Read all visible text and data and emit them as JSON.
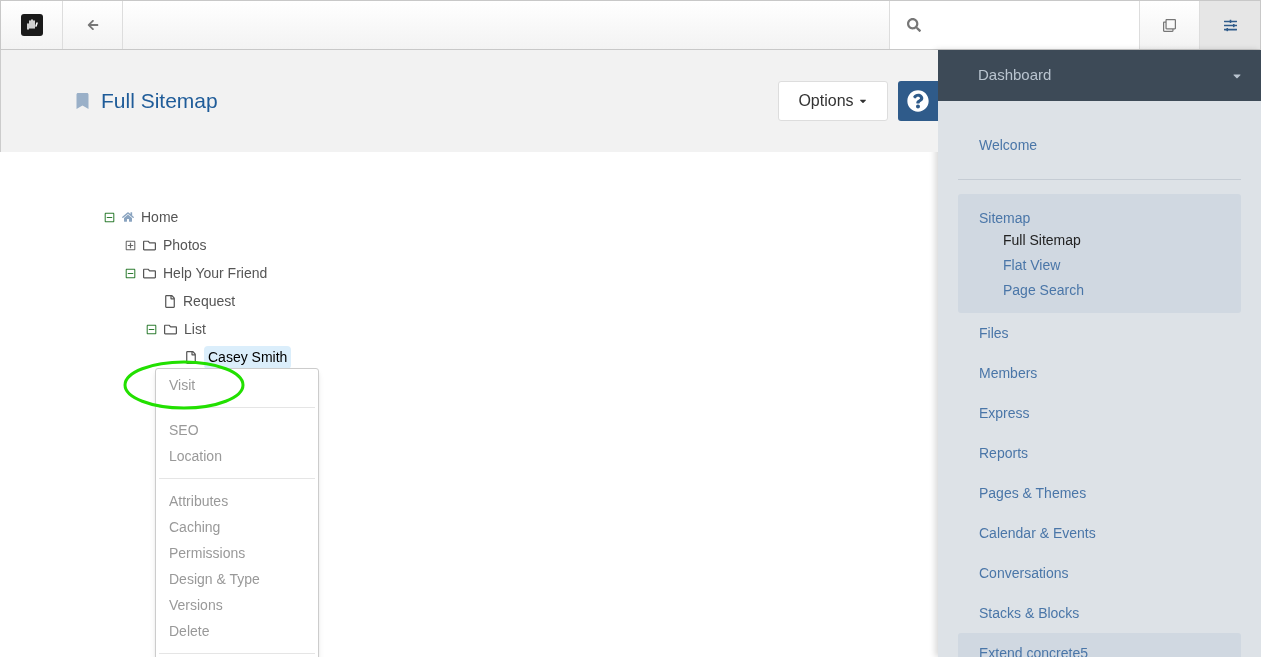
{
  "page": {
    "title": "Full Sitemap"
  },
  "header_buttons": {
    "options": "Options"
  },
  "tree": [
    {
      "kind": "home",
      "label": "Home",
      "expanded": true,
      "selected": false,
      "children": [
        {
          "kind": "folder",
          "label": "Photos",
          "expanded": false,
          "selected": false
        },
        {
          "kind": "folder",
          "label": "Help Your Friend",
          "expanded": true,
          "selected": false,
          "children": [
            {
              "kind": "page",
              "label": "Request",
              "selected": false
            },
            {
              "kind": "folder",
              "label": "List",
              "expanded": true,
              "selected": false,
              "children": [
                {
                  "kind": "page",
                  "label": "Casey Smith",
                  "selected": true
                }
              ]
            }
          ]
        }
      ]
    }
  ],
  "context_menu": {
    "groups": [
      [
        "Visit"
      ],
      [
        "SEO",
        "Location"
      ],
      [
        "Attributes",
        "Caching",
        "Permissions",
        "Design & Type",
        "Versions",
        "Delete"
      ]
    ]
  },
  "sidebar": {
    "header": "Dashboard",
    "items": [
      {
        "label": "Welcome",
        "selected": false
      },
      {
        "label": "Sitemap",
        "selected": true,
        "children": [
          {
            "label": "Full Sitemap",
            "selected": true
          },
          {
            "label": "Flat View",
            "selected": false
          },
          {
            "label": "Page Search",
            "selected": false
          }
        ]
      },
      {
        "label": "Files",
        "selected": false
      },
      {
        "label": "Members",
        "selected": false
      },
      {
        "label": "Express",
        "selected": false
      },
      {
        "label": "Reports",
        "selected": false
      },
      {
        "label": "Pages & Themes",
        "selected": false
      },
      {
        "label": "Calendar & Events",
        "selected": false
      },
      {
        "label": "Conversations",
        "selected": false
      },
      {
        "label": "Stacks & Blocks",
        "selected": false
      },
      {
        "label": "Extend concrete5",
        "selected": true
      }
    ]
  }
}
